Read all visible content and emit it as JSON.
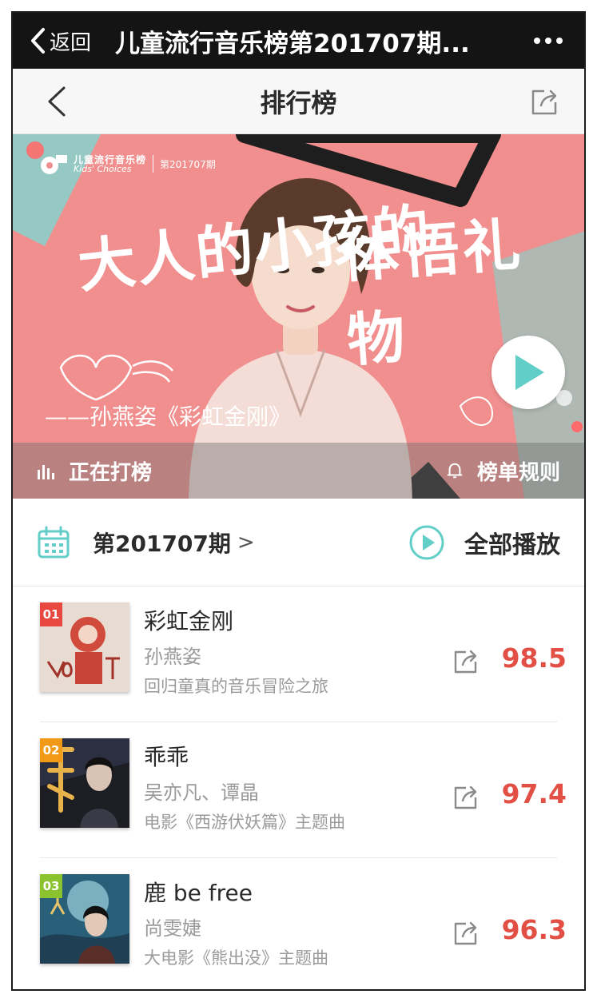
{
  "wx_bar": {
    "back_label": "返回",
    "title": "儿童流行音乐榜第201707期..."
  },
  "header": {
    "title": "排行榜"
  },
  "banner": {
    "logo_cn": "儿童流行音乐榜",
    "logo_en": "Kids' Choices",
    "logo_issue": "第201707期",
    "headline_left": "大人的小孩的",
    "headline_right": "体悟礼物",
    "credit": "——孙燕姿《彩虹金刚》",
    "strip_left_label": "正在打榜",
    "strip_right_label": "榜单规则",
    "colors": {
      "background": "#f08f8e",
      "accent": "#62cec8"
    }
  },
  "issue_row": {
    "issue_label": "第201707期",
    "chevron": ">",
    "play_all_label": "全部播放"
  },
  "songs": [
    {
      "rank": "01",
      "title": "彩虹金刚",
      "artist": "孙燕姿",
      "desc": "回归童真的音乐冒险之旅",
      "score": "98.5",
      "badge_color": "#e8483f"
    },
    {
      "rank": "02",
      "title": "乖乖",
      "artist": "吴亦凡、谭晶",
      "desc": "电影《西游伏妖篇》主题曲",
      "score": "97.4",
      "badge_color": "#f29a17"
    },
    {
      "rank": "03",
      "title": "鹿 be free",
      "artist": "尚雯婕",
      "desc": "大电影《熊出没》主题曲",
      "score": "96.3",
      "badge_color": "#8bc32f"
    }
  ],
  "colors": {
    "score": "#e24f45",
    "teal": "#62cec8"
  }
}
